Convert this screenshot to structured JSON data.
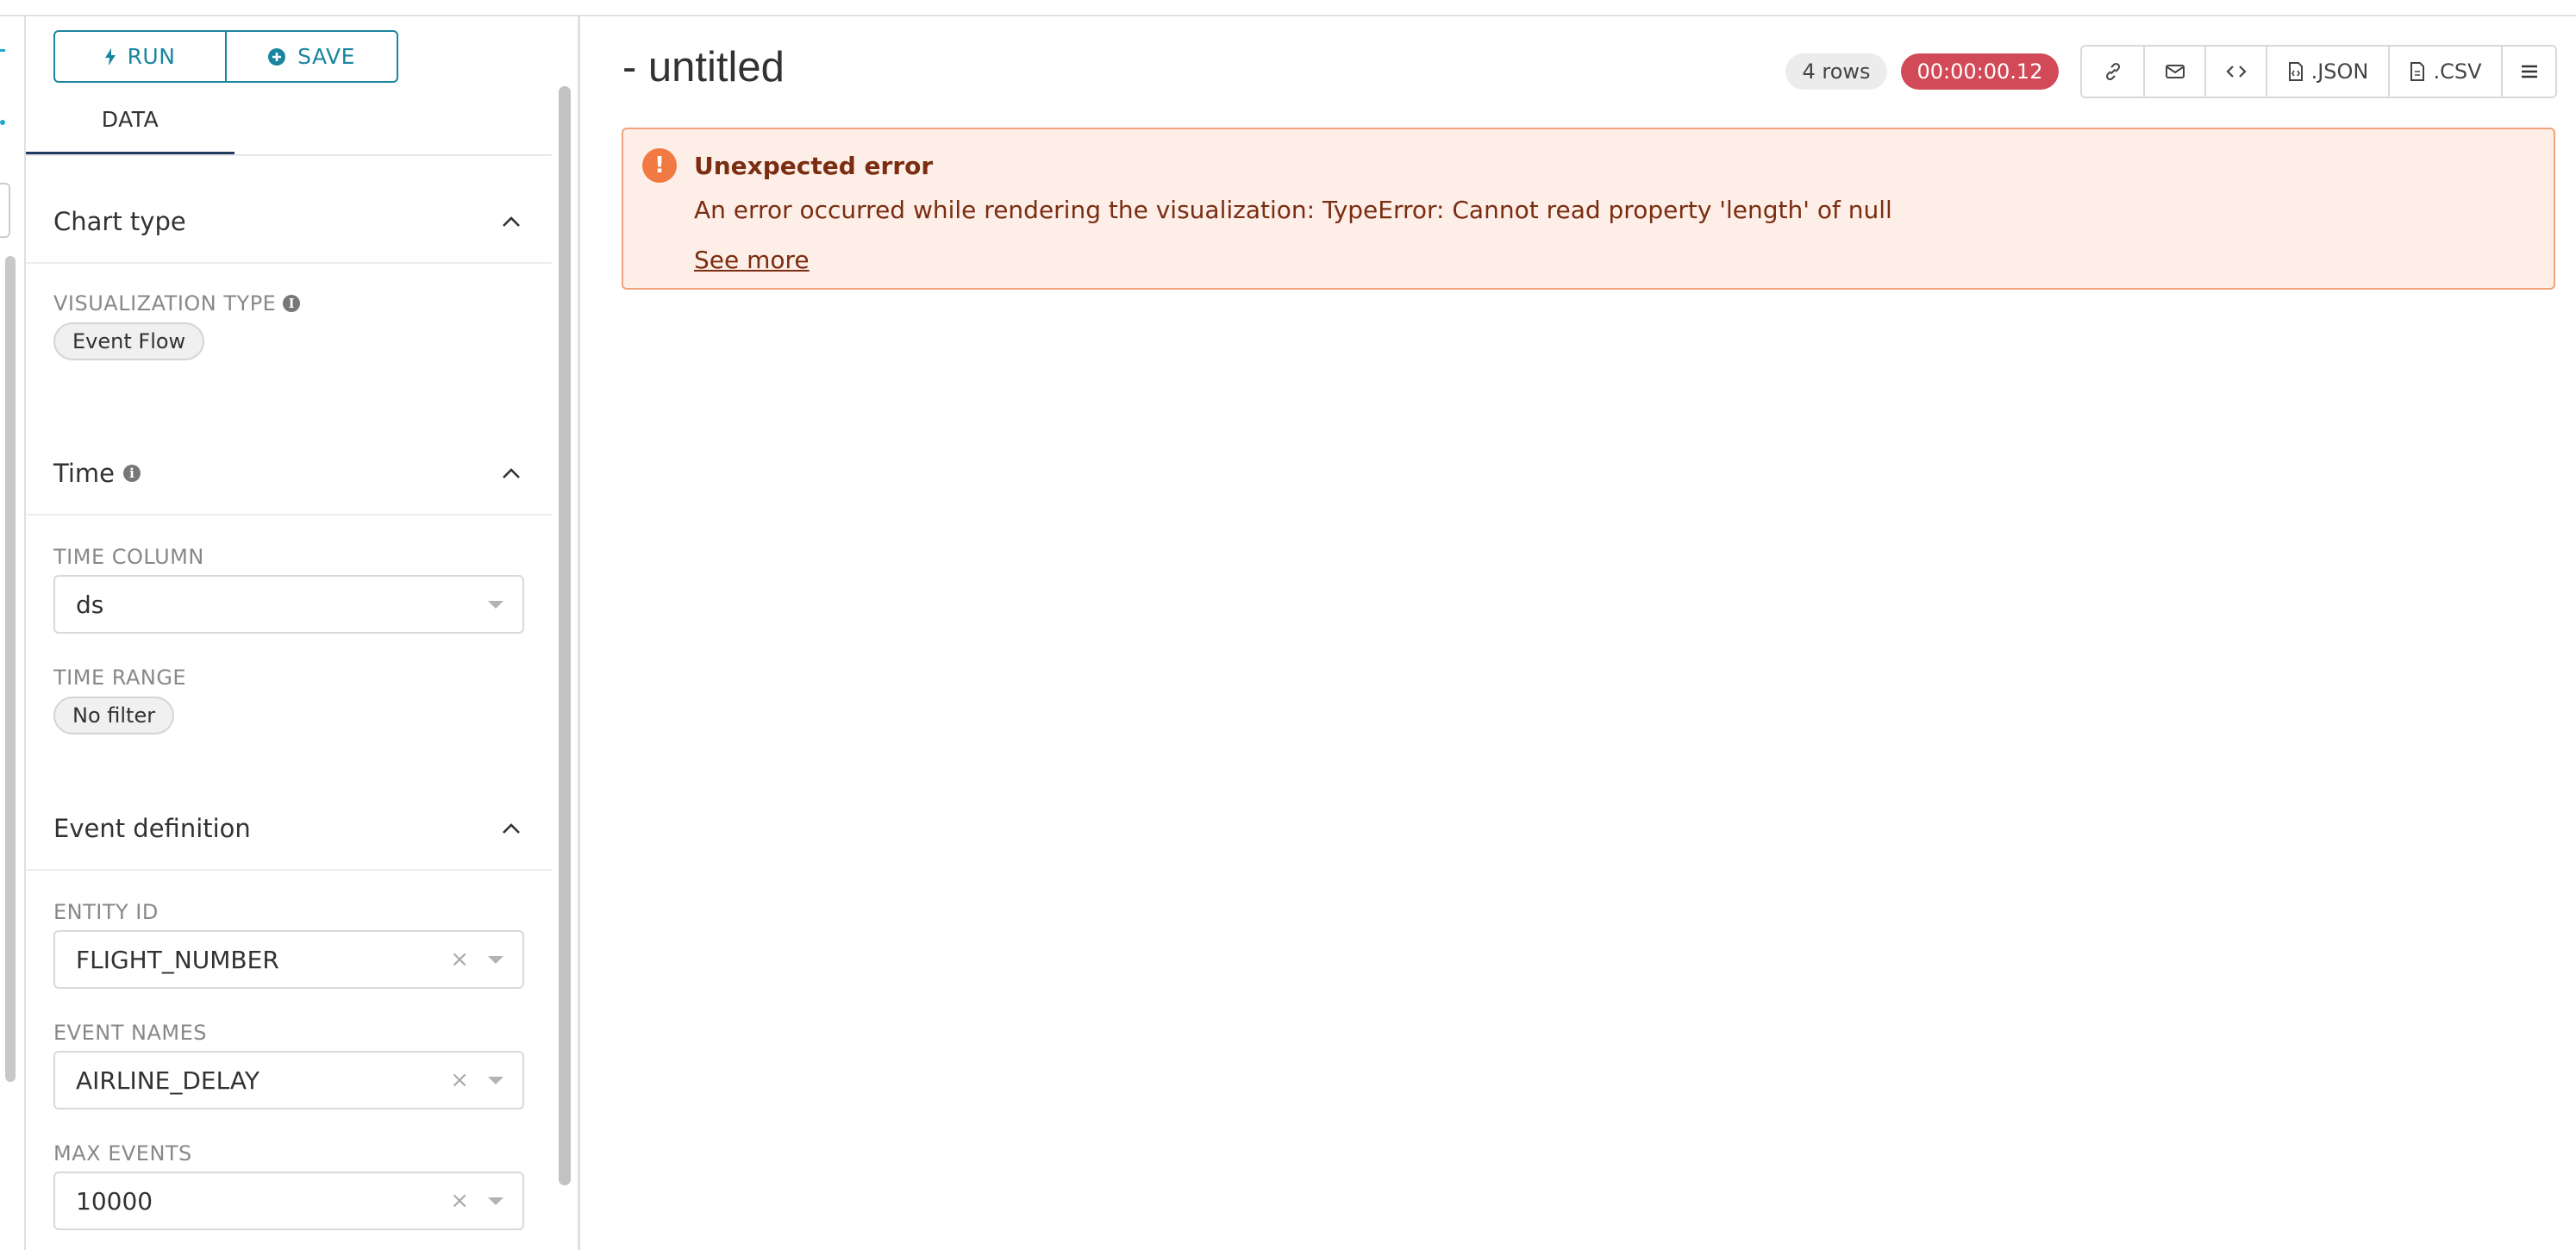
{
  "toolbar": {
    "run_label": "RUN",
    "save_label": "SAVE"
  },
  "tabs": {
    "data_label": "DATA"
  },
  "sections": {
    "chart_type": {
      "title": "Chart type",
      "viz_type_label": "VISUALIZATION TYPE",
      "viz_type_value": "Event Flow"
    },
    "time": {
      "title": "Time",
      "time_column_label": "TIME COLUMN",
      "time_column_value": "ds",
      "time_range_label": "TIME RANGE",
      "time_range_value": "No filter"
    },
    "event_definition": {
      "title": "Event definition",
      "entity_id_label": "ENTITY ID",
      "entity_id_value": "FLIGHT_NUMBER",
      "event_names_label": "EVENT NAMES",
      "event_names_value": "AIRLINE_DELAY",
      "max_events_label": "MAX EVENTS",
      "max_events_value": "10000",
      "clear_symbol": "×"
    }
  },
  "header": {
    "title": "- untitled",
    "rows_badge": "4 rows",
    "time_badge": "00:00:00.12"
  },
  "actions": {
    "json_label": ".JSON",
    "csv_label": ".CSV"
  },
  "error": {
    "icon_glyph": "!",
    "title": "Unexpected error",
    "message": "An error occurred while rendering the visualization: TypeError: Cannot read property 'length' of null",
    "link": "See more"
  },
  "icons": {
    "run": "bolt-icon",
    "save": "plus-circle-icon",
    "link": "link-icon",
    "email": "mail-icon",
    "embed": "code-icon",
    "json": "file-json-icon",
    "csv": "file-icon",
    "menu": "hamburger-menu-icon"
  },
  "colors": {
    "accent": "#1a85a0",
    "time_badge": "#d24a57",
    "error_bg": "#fdeee8",
    "error_border": "#f0a27a",
    "error_icon": "#f07a41",
    "error_text": "#7a2d10"
  }
}
